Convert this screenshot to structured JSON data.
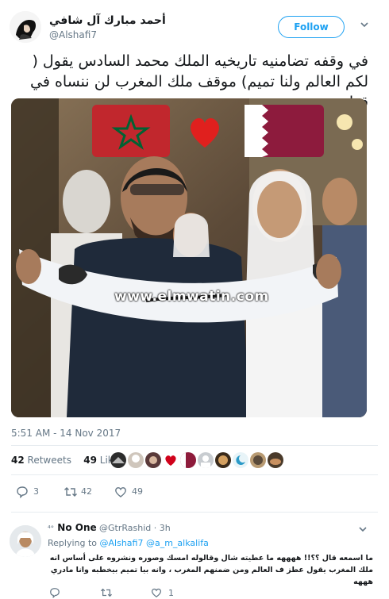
{
  "author": {
    "display_name": "أحمد مبارك آل شافي",
    "handle": "@Alshafi7"
  },
  "follow_label": "Follow",
  "tweet_text": "في وقفه تضامنيه تاريخيه الملك محمد السادس يقول ( لكم العالم ولنا تميم) موقف ملك المغرب لن ننساه في قطر .",
  "media": {
    "watermark": "www.elmwatin.com",
    "flags": [
      "morocco-flag-emoji",
      "red-heart-emoji",
      "qatar-flag-emoji"
    ]
  },
  "timestamp": "5:51 AM - 14 Nov 2017",
  "stats": {
    "retweets_count": "42",
    "retweets_label": "Retweets",
    "likes_count": "49",
    "likes_label": "Likes"
  },
  "actions": {
    "reply_count": "3",
    "retweet_count": "42",
    "like_count": "49"
  },
  "reply": {
    "name": "No One",
    "handle": "@GtrRashid",
    "time": "· 3h",
    "replying_to_label": "Replying to",
    "replying_to_1": "@Alshafi7",
    "replying_to_2": "@a_m_alkalifa",
    "text": "ما اسمعه قال ؟؟!! ههههه ما عطيته شال وقالوله امسك وصوره ونشروه على أساس انه ملك المغرب يقول عطز ف العالم ومن ضمنهم المغرب ، وانه بيا تميم بيخطبه وانا مادري هههه",
    "actions": {
      "like_count": "1"
    }
  },
  "colors": {
    "accent": "#1da1f2",
    "muted": "#657786",
    "divider": "#e6ecf0"
  }
}
